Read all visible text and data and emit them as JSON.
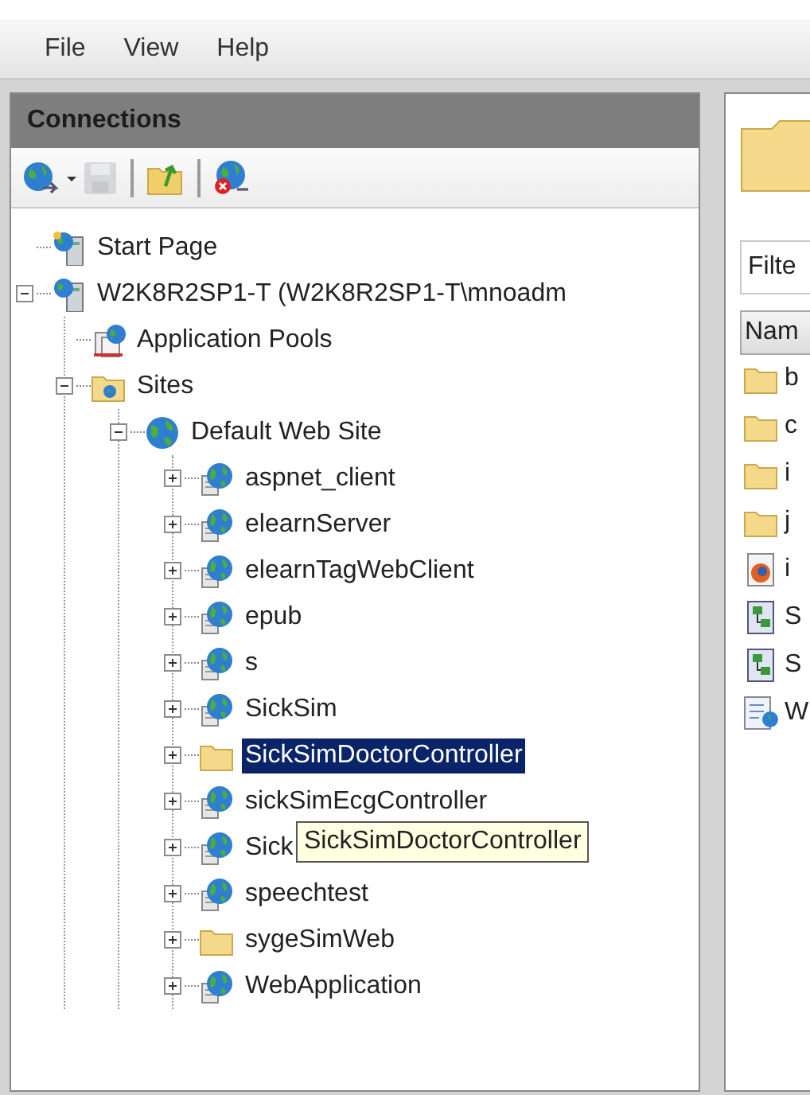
{
  "menu": [
    {
      "label": "File"
    },
    {
      "label": "View"
    },
    {
      "label": "Help"
    }
  ],
  "connections": {
    "title": "Connections",
    "toolbar": [
      {
        "kind": "connect",
        "disabled": false
      },
      {
        "kind": "dropdown",
        "disabled": false
      },
      {
        "kind": "save",
        "disabled": true
      },
      {
        "kind": "separator"
      },
      {
        "kind": "folder-up",
        "disabled": false
      },
      {
        "kind": "separator"
      },
      {
        "kind": "disconnect",
        "disabled": false
      }
    ],
    "tree": [
      {
        "label": "Start Page",
        "kind": "start-page",
        "selected": false
      },
      {
        "label": "W2K8R2SP1-T (W2K8R2SP1-T\\mnoadm",
        "kind": "server",
        "expanded": true,
        "selected": false,
        "children": [
          {
            "label": "Application Pools",
            "kind": "app-pools",
            "selected": false
          },
          {
            "label": "Sites",
            "kind": "sites",
            "expanded": true,
            "selected": false,
            "children": [
              {
                "label": "Default Web Site",
                "kind": "globe",
                "expanded": true,
                "selected": false,
                "children": [
                  {
                    "label": "aspnet_client",
                    "kind": "site",
                    "expanded": false,
                    "selected": false
                  },
                  {
                    "label": "elearnServer",
                    "kind": "site",
                    "expanded": false,
                    "selected": false
                  },
                  {
                    "label": "elearnTagWebClient",
                    "kind": "site",
                    "expanded": false,
                    "selected": false
                  },
                  {
                    "label": "epub",
                    "kind": "site",
                    "expanded": false,
                    "selected": false
                  },
                  {
                    "label": "s",
                    "kind": "site",
                    "expanded": false,
                    "selected": false
                  },
                  {
                    "label": "SickSim",
                    "kind": "site",
                    "expanded": false,
                    "selected": false
                  },
                  {
                    "label": "SickSimDoctorController",
                    "kind": "folder",
                    "expanded": false,
                    "selected": true
                  },
                  {
                    "label": "sickSimEcgController",
                    "kind": "site",
                    "expanded": false,
                    "selected": false
                  },
                  {
                    "label": "Sick",
                    "kind": "site",
                    "expanded": false,
                    "selected": false,
                    "tooltip": "SickSimDoctorController"
                  },
                  {
                    "label": "speechtest",
                    "kind": "site",
                    "expanded": false,
                    "selected": false
                  },
                  {
                    "label": "sygeSimWeb",
                    "kind": "folder",
                    "expanded": false,
                    "selected": false
                  },
                  {
                    "label": "WebApplication",
                    "kind": "site",
                    "expanded": false,
                    "selected": false
                  }
                ]
              }
            ]
          }
        ]
      }
    ]
  },
  "content": {
    "filter_label": "Filte",
    "column_header": "Nam",
    "rows": [
      {
        "kind": "folder",
        "name": "b"
      },
      {
        "kind": "folder",
        "name": "c"
      },
      {
        "kind": "folder",
        "name": "i"
      },
      {
        "kind": "folder",
        "name": "j"
      },
      {
        "kind": "browser-page",
        "name": "i"
      },
      {
        "kind": "sitemap",
        "name": "S"
      },
      {
        "kind": "sitemap",
        "name": "S"
      },
      {
        "kind": "document",
        "name": "W"
      }
    ]
  }
}
